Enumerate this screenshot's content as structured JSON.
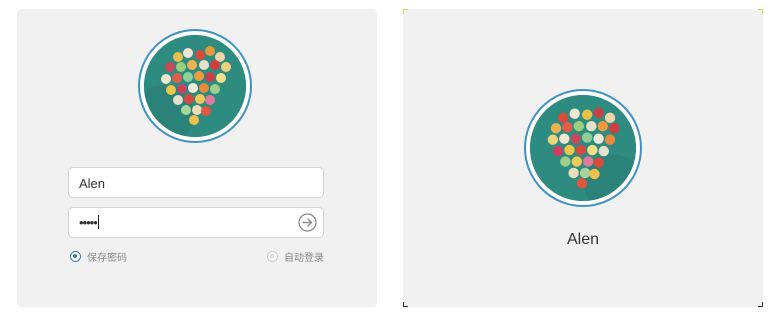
{
  "login": {
    "username_value": "Alen",
    "password_mask": "•••••",
    "remember_password_label": "保存密码",
    "remember_password_checked": true,
    "auto_login_label": "自动登录",
    "auto_login_checked": false,
    "submit_icon": "arrow-right-circle-icon"
  },
  "profile": {
    "username": "Alen"
  },
  "colors": {
    "panel_bg": "#f1f1f1",
    "avatar_ring": "#3f93c2",
    "radio_accent": "#3a78bd",
    "corner_marker": "#e0d64a"
  }
}
